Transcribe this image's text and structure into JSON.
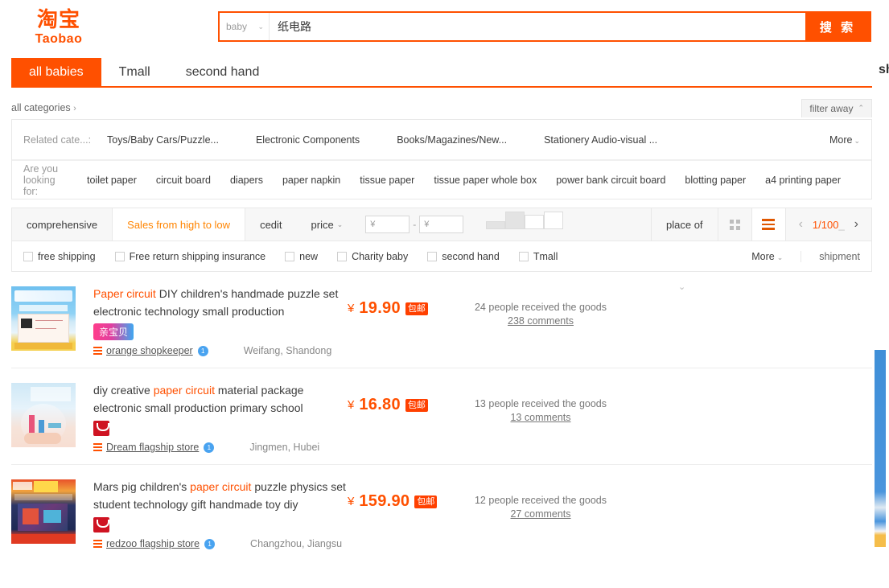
{
  "header": {
    "logo_cn": "淘宝",
    "logo_en": "Taobao",
    "search": {
      "category": "baby",
      "category_caret": "⌄",
      "query": "纸电路",
      "placeholder": "",
      "button_label": "搜 索"
    },
    "tabs": [
      {
        "label": "all babies",
        "active": true
      },
      {
        "label": "Tmall",
        "active": false
      },
      {
        "label": "second hand",
        "active": false
      }
    ],
    "edge_cut_text": "sh"
  },
  "filters": {
    "all_categories": "all categories",
    "all_categories_arrow": "›",
    "filter_away": "filter away",
    "filter_away_caret": "⌃",
    "related_label": "Related cate...:",
    "related_items": [
      "Toys/Baby Cars/Puzzle...",
      "Electronic Components",
      "Books/Magazines/New...",
      "Stationery Audio-visual ..."
    ],
    "more_label": "More",
    "more_caret": "⌄",
    "suggest_label": "Are you looking for:",
    "suggestions": [
      "toilet paper",
      "circuit board",
      "diapers",
      "paper napkin",
      "tissue paper",
      "tissue paper whole box",
      "power bank circuit board",
      "blotting paper",
      "a4 printing paper"
    ]
  },
  "sortbar": {
    "items": [
      {
        "label": "comprehensive",
        "active": false
      },
      {
        "label": "Sales from high to low",
        "active": true
      },
      {
        "label": "cedit",
        "active": false
      },
      {
        "label": "price",
        "caret": "⌄",
        "active": false
      }
    ],
    "price_min_symbol": "¥",
    "price_min_value": "",
    "price_max_symbol": "¥",
    "price_max_value": "",
    "price_dash": "-",
    "place_of": "place of",
    "grid_view_icon": "grid-view-icon",
    "list_view_icon": "list-view-icon",
    "prev_arrow": "‹",
    "next_arrow": "›",
    "page_current": "1/100",
    "page_suffix": "_",
    "checkboxes": [
      {
        "label": "free shipping",
        "checked": false
      },
      {
        "label": "Free return shipping insurance",
        "checked": false
      },
      {
        "label": "new",
        "checked": false
      },
      {
        "label": "Charity baby",
        "checked": false
      },
      {
        "label": "second hand",
        "checked": false
      },
      {
        "label": "Tmall",
        "checked": false
      }
    ],
    "checkbox_more": "More",
    "checkbox_more_caret": "⌄",
    "shipment": "shipment"
  },
  "results": {
    "collapse_caret": "⌄",
    "items": [
      {
        "title_pre": "",
        "title_highlight": "Paper circuit",
        "title_post": " DIY children's handmade puzzle set electronic technology small production",
        "badge_text": "亲宝贝",
        "badge_type": "promo",
        "shop": "orange shopkeeper",
        "shop_rank": "1",
        "location": "Weifang, Shandong",
        "currency": "¥",
        "price": "19.90",
        "free_shipping_badge": "包邮",
        "sold": "24 people received the goods",
        "comments": "238 comments"
      },
      {
        "title_pre": "diy creative ",
        "title_highlight": "paper circuit",
        "title_post": " material package electronic small production primary school",
        "badge_text": "",
        "badge_type": "tmall",
        "shop": "Dream flagship store",
        "shop_rank": "1",
        "location": "Jingmen, Hubei",
        "currency": "¥",
        "price": "16.80",
        "free_shipping_badge": "包邮",
        "sold": "13 people received the goods",
        "comments": "13 comments"
      },
      {
        "title_pre": "Mars pig children's ",
        "title_highlight": "paper circuit",
        "title_post": " puzzle physics set student technology gift handmade toy diy",
        "badge_text": "",
        "badge_type": "tmall",
        "shop": "redzoo flagship store",
        "shop_rank": "1",
        "location": "Changzhou, Jiangsu",
        "currency": "¥",
        "price": "159.90",
        "free_shipping_badge": "包邮",
        "sold": "12 people received the goods",
        "comments": "27 comments"
      }
    ]
  },
  "colors": {
    "brand_orange": "#ff5000",
    "accent_orange": "#ff8400",
    "tmall_red": "#cf1322",
    "link_blue": "#49a3f0"
  }
}
